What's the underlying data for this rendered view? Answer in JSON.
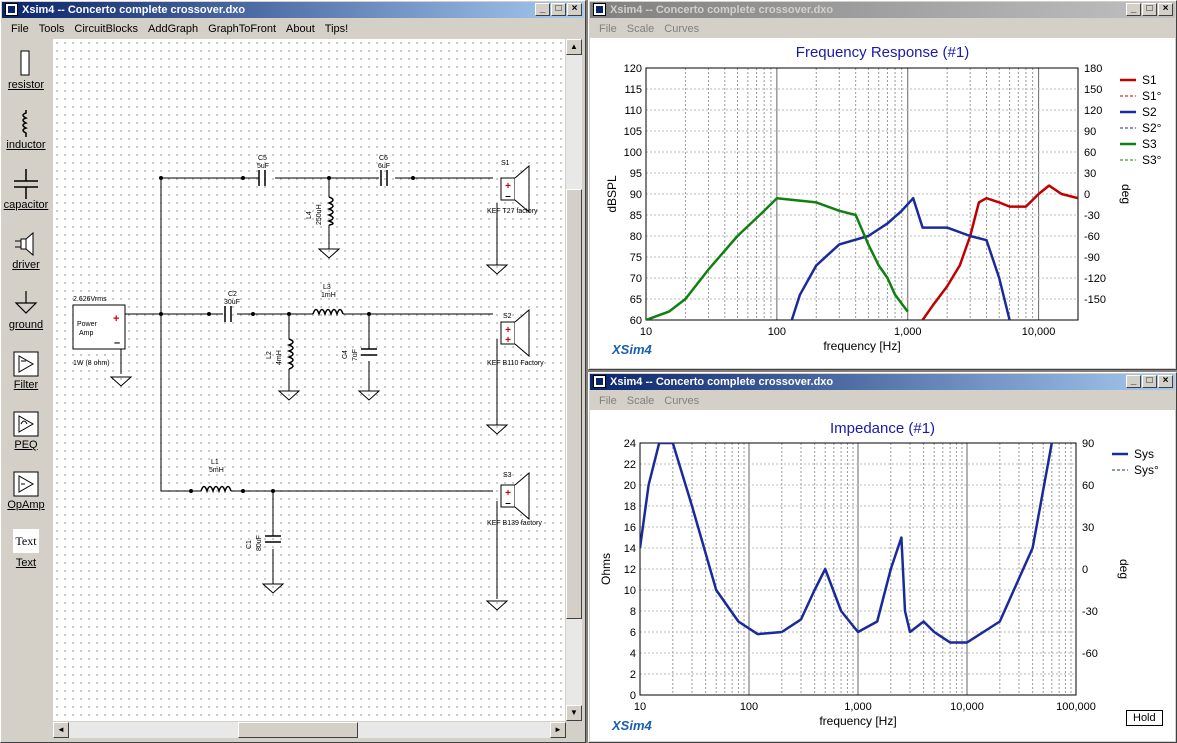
{
  "schematic_window": {
    "title": "Xsim4 -- Concerto complete crossover.dxo",
    "menu": [
      "File",
      "Tools",
      "CircuitBlocks",
      "AddGraph",
      "GraphToFront",
      "About",
      "Tips!"
    ]
  },
  "palette": [
    {
      "label": "resistor",
      "icon": "resistor-icon"
    },
    {
      "label": "inductor",
      "icon": "inductor-icon"
    },
    {
      "label": "capacitor",
      "icon": "capacitor-icon"
    },
    {
      "label": "driver",
      "icon": "driver-icon"
    },
    {
      "label": "ground",
      "icon": "ground-icon"
    },
    {
      "label": "Filter",
      "icon": "filter-icon"
    },
    {
      "label": "PEQ",
      "icon": "peq-icon"
    },
    {
      "label": "OpAmp",
      "icon": "opamp-icon"
    },
    {
      "label": "Text",
      "icon": "text-icon",
      "icon_text": "Text"
    }
  ],
  "circuit": {
    "amp": {
      "label1": "Power",
      "label2": "Amp",
      "volts": "2.626Vrms",
      "power": "1W (8 ohm)"
    },
    "C5": {
      "name": "C5",
      "value": "5uF"
    },
    "C6": {
      "name": "C6",
      "value": "6uF"
    },
    "L4": {
      "name": "L4",
      "value": "250uH"
    },
    "S1": {
      "name": "S1",
      "model": "KEF T27 factory"
    },
    "C2": {
      "name": "C2",
      "value": "30uF"
    },
    "L3": {
      "name": "L3",
      "value": "1mH"
    },
    "L2": {
      "name": "L2",
      "value": "4mH"
    },
    "C4": {
      "name": "C4",
      "value": "7uF"
    },
    "S2": {
      "name": "S2",
      "model": "KEF B110 Factory"
    },
    "L1": {
      "name": "L1",
      "value": "5mH"
    },
    "C1": {
      "name": "C1",
      "value": "80uF"
    },
    "S3": {
      "name": "S3",
      "model": "KEF B139 factory"
    }
  },
  "fr_window": {
    "title": "Xsim4 -- Concerto complete crossover.dxo",
    "menu": [
      "File",
      "Scale",
      "Curves"
    ],
    "brand": "XSim4",
    "chart_data": {
      "type": "line",
      "title": "Frequency Response (#1)",
      "xlabel": "frequency [Hz]",
      "ylabel": "dBSPL",
      "y2label": "deg",
      "xscale": "log",
      "xlim": [
        10,
        20000
      ],
      "ylim": [
        60,
        120
      ],
      "y2lim": [
        -180,
        180
      ],
      "x_ticks": [
        "10",
        "100",
        "1,000",
        "10,000"
      ],
      "y_ticks": [
        "60",
        "65",
        "70",
        "75",
        "80",
        "85",
        "90",
        "95",
        "100",
        "105",
        "110",
        "115",
        "120"
      ],
      "y2_ticks": [
        "-150",
        "-120",
        "-90",
        "-60",
        "-30",
        "0",
        "30",
        "60",
        "90",
        "120",
        "150",
        "180"
      ],
      "legend": [
        "S1",
        "S1°",
        "S2",
        "S2°",
        "S3",
        "S3°"
      ],
      "legend_position": "right",
      "colors": {
        "S1": "#c00000",
        "S2": "#1a2a9a",
        "S3": "#108010"
      },
      "series": [
        {
          "name": "S1",
          "x": [
            1300,
            1600,
            2000,
            2500,
            3000,
            3500,
            4000,
            5000,
            6000,
            8000,
            10000,
            12000,
            15000,
            20000
          ],
          "y": [
            60,
            64,
            68,
            73,
            80,
            88,
            89,
            88,
            87,
            87,
            90,
            92,
            90,
            89
          ]
        },
        {
          "name": "S2",
          "x": [
            130,
            150,
            200,
            300,
            500,
            700,
            900,
            1100,
            1300,
            2000,
            3000,
            4000,
            5000,
            6000
          ],
          "y": [
            60,
            66,
            73,
            78,
            80,
            83,
            86,
            89,
            82,
            82,
            80,
            79,
            70,
            60
          ]
        },
        {
          "name": "S3",
          "x": [
            10,
            15,
            20,
            30,
            50,
            80,
            100,
            200,
            300,
            400,
            500,
            600,
            700,
            800,
            1000
          ],
          "y": [
            60,
            62,
            65,
            72,
            80,
            86,
            89,
            88,
            86,
            85,
            78,
            73,
            70,
            66,
            62
          ]
        }
      ]
    }
  },
  "imp_window": {
    "title": "Xsim4 -- Concerto complete crossover.dxo",
    "menu": [
      "File",
      "Scale",
      "Curves"
    ],
    "brand": "XSim4",
    "hold_label": "Hold",
    "chart_data": {
      "type": "line",
      "title": "Impedance (#1)",
      "xlabel": "frequency [Hz]",
      "ylabel": "Ohms",
      "y2label": "deg",
      "xscale": "log",
      "xlim": [
        10,
        100000
      ],
      "ylim": [
        0,
        24
      ],
      "y2lim": [
        -90,
        90
      ],
      "x_ticks": [
        "10",
        "100",
        "1,000",
        "10,000",
        "100,000"
      ],
      "y_ticks": [
        "0",
        "2",
        "4",
        "6",
        "8",
        "10",
        "12",
        "14",
        "16",
        "18",
        "20",
        "22",
        "24"
      ],
      "y2_ticks": [
        "-60",
        "-30",
        "0",
        "30",
        "60",
        "90"
      ],
      "legend": [
        "Sys",
        "Sys°"
      ],
      "legend_position": "top-right",
      "series": [
        {
          "name": "Sys",
          "x": [
            10,
            12,
            15,
            20,
            30,
            50,
            80,
            120,
            200,
            300,
            400,
            500,
            700,
            1000,
            1500,
            2000,
            2500,
            2700,
            3000,
            4000,
            5000,
            7000,
            10000,
            20000,
            40000,
            60000
          ],
          "y": [
            14,
            20,
            24,
            24,
            18,
            10,
            7,
            5.8,
            6,
            7.2,
            10,
            12,
            8,
            6,
            7,
            12,
            15,
            8,
            6,
            7,
            6,
            5,
            5,
            7,
            14,
            24
          ]
        }
      ]
    }
  }
}
